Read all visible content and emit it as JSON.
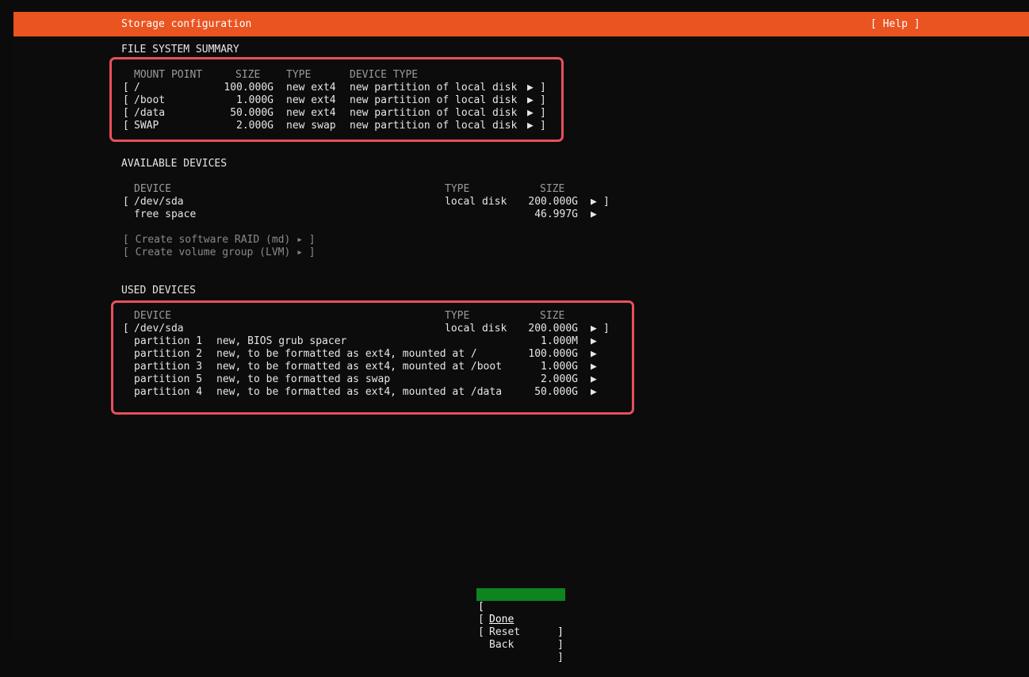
{
  "header": {
    "title": "Storage configuration",
    "help": "[ Help ]"
  },
  "fs_summary": {
    "heading": "FILE SYSTEM SUMMARY",
    "columns": [
      "MOUNT POINT",
      "SIZE",
      "TYPE",
      "DEVICE TYPE"
    ],
    "rows": [
      {
        "mount": "/",
        "size": "100.000G",
        "type": "new ext4",
        "device_type": "new partition of local disk"
      },
      {
        "mount": "/boot",
        "size": "1.000G",
        "type": "new ext4",
        "device_type": "new partition of local disk"
      },
      {
        "mount": "/data",
        "size": "50.000G",
        "type": "new ext4",
        "device_type": "new partition of local disk"
      },
      {
        "mount": "SWAP",
        "size": "2.000G",
        "type": "new swap",
        "device_type": "new partition of local disk"
      }
    ]
  },
  "available": {
    "heading": "AVAILABLE DEVICES",
    "columns": [
      "DEVICE",
      "TYPE",
      "SIZE"
    ],
    "device": {
      "name": "/dev/sda",
      "type": "local disk",
      "size": "200.000G"
    },
    "free": {
      "label": "free space",
      "size": "46.997G"
    },
    "actions": [
      "[ Create software RAID (md) ▸ ]",
      "[ Create volume group (LVM) ▸ ]"
    ]
  },
  "used": {
    "heading": "USED DEVICES",
    "columns": [
      "DEVICE",
      "TYPE",
      "SIZE"
    ],
    "device": {
      "name": "/dev/sda",
      "type": "local disk",
      "size": "200.000G"
    },
    "partitions": [
      {
        "name": "partition 1",
        "desc": "new, BIOS grub spacer",
        "size": "1.000M"
      },
      {
        "name": "partition 2",
        "desc": "new, to be formatted as ext4, mounted at /",
        "size": "100.000G"
      },
      {
        "name": "partition 3",
        "desc": "new, to be formatted as ext4, mounted at /boot",
        "size": "1.000G"
      },
      {
        "name": "partition 5",
        "desc": "new, to be formatted as swap",
        "size": "2.000G"
      },
      {
        "name": "partition 4",
        "desc": "new, to be formatted as ext4, mounted at /data",
        "size": "50.000G"
      }
    ]
  },
  "buttons": {
    "done": "Done",
    "reset": "Reset",
    "back": "Back"
  },
  "glyphs": {
    "arrow": "▶",
    "open_bracket": "[",
    "close_bracket": "]"
  },
  "colors": {
    "accent": "#e95420",
    "focus": "#0e8420",
    "highlight": "#e8505b"
  }
}
